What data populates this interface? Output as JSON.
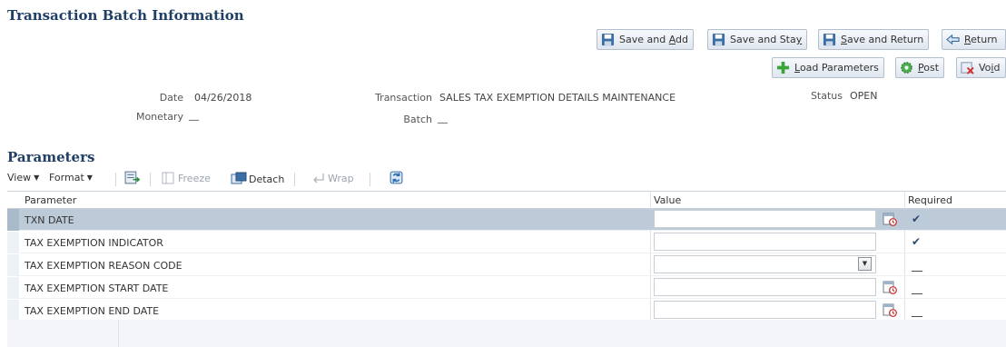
{
  "page": {
    "title": "Transaction Batch Information"
  },
  "buttons": {
    "save_and_add": {
      "prefix": "Save and ",
      "key": "A",
      "suffix": "dd",
      "icon": "floppy-disk-icon"
    },
    "save_and_stay": {
      "prefix": "Save and Sta",
      "key": "y",
      "suffix": "",
      "icon": "floppy-disk-icon"
    },
    "save_and_return": {
      "prefix": "",
      "key": "S",
      "suffix": "ave and Return",
      "icon": "floppy-disk-icon"
    },
    "return": {
      "prefix": "",
      "key": "R",
      "suffix": "eturn",
      "icon": "back-arrow-icon"
    },
    "load_parameters": {
      "prefix": "",
      "key": "L",
      "suffix": "oad Parameters",
      "icon": "green-plus-icon"
    },
    "post": {
      "prefix": "",
      "key": "P",
      "suffix": "ost",
      "icon": "gear-icon"
    },
    "void": {
      "prefix": "Vo",
      "key": "i",
      "suffix": "d",
      "icon": "void-x-icon"
    }
  },
  "info": {
    "date": {
      "label": "Date",
      "value": "04/26/2018"
    },
    "monetary": {
      "label": "Monetary",
      "value": "__"
    },
    "transaction": {
      "label": "Transaction",
      "value": "SALES TAX EXEMPTION DETAILS MAINTENANCE"
    },
    "batch": {
      "label": "Batch",
      "value": "__"
    },
    "status": {
      "label": "Status",
      "value": "OPEN"
    }
  },
  "parameters": {
    "title": "Parameters",
    "toolbar": {
      "view": "View",
      "format": "Format",
      "freeze": "Freeze",
      "detach": "Detach",
      "wrap": "Wrap"
    },
    "columns": {
      "parameter": "Parameter",
      "value": "Value",
      "required": "Required"
    },
    "rows": [
      {
        "parameter": "TXN DATE",
        "value": "",
        "required": "✔",
        "control": "date",
        "selected": true
      },
      {
        "parameter": "TAX EXEMPTION INDICATOR",
        "value": "",
        "required": "✔",
        "control": "text",
        "selected": false
      },
      {
        "parameter": "TAX EXEMPTION REASON CODE",
        "value": "",
        "required": "__",
        "control": "select",
        "selected": false
      },
      {
        "parameter": "TAX EXEMPTION START DATE",
        "value": "",
        "required": "__",
        "control": "date",
        "selected": false
      },
      {
        "parameter": "TAX EXEMPTION END DATE",
        "value": "",
        "required": "__",
        "control": "date",
        "selected": false
      }
    ]
  },
  "colors": {
    "title": "#1f3f66",
    "selected_row": "#bdcbd9",
    "button_border": "#b4bfcc"
  }
}
